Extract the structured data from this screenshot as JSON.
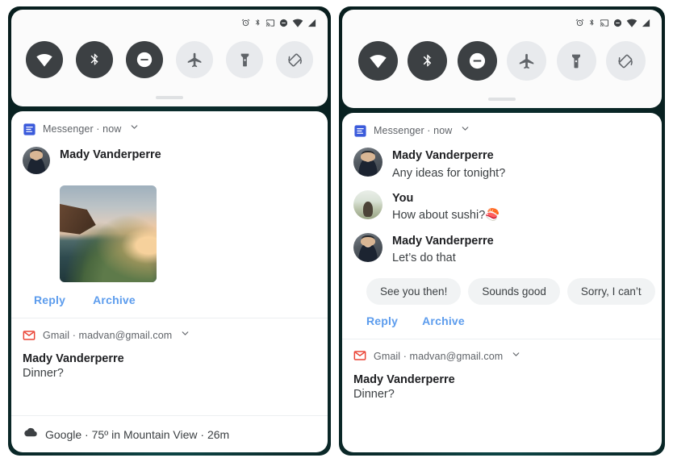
{
  "status_bar": {
    "icons": [
      "alarm-icon",
      "bluetooth-icon",
      "cast-icon",
      "do-not-disturb-icon",
      "wifi-icon",
      "cellular-signal-icon"
    ]
  },
  "quick_settings": {
    "tiles": [
      {
        "name": "wifi",
        "label": "Wi-Fi",
        "state": "on"
      },
      {
        "name": "bluetooth",
        "label": "Bluetooth",
        "state": "on"
      },
      {
        "name": "dnd",
        "label": "Do Not Disturb",
        "state": "on"
      },
      {
        "name": "airplane",
        "label": "Airplane mode",
        "state": "off"
      },
      {
        "name": "flashlight",
        "label": "Flashlight",
        "state": "off"
      },
      {
        "name": "autorotate",
        "label": "Auto-rotate",
        "state": "off"
      }
    ]
  },
  "left_panel": {
    "messenger": {
      "app_name": "Messenger",
      "separator": "·",
      "time": "now",
      "sender": "Mady Vanderperre",
      "attachment_alt": "coastal sunset photo",
      "actions": [
        "Reply",
        "Archive"
      ]
    },
    "gmail": {
      "app_name": "Gmail",
      "separator": "·",
      "account": "madvan@gmail.com",
      "title": "Mady Vanderperre",
      "text": "Dinner?"
    },
    "google": {
      "text": "Google · 75º in Mountain View · 26m"
    }
  },
  "right_panel": {
    "messenger": {
      "app_name": "Messenger",
      "separator": "·",
      "time": "now",
      "messages": [
        {
          "sender": "Mady Vanderperre",
          "text": "Any ideas for tonight?",
          "avatar": "person"
        },
        {
          "sender": "You",
          "text": "How about sushi?🍣",
          "avatar": "outdoor"
        },
        {
          "sender": "Mady Vanderperre",
          "text": "Let’s do that",
          "avatar": "person"
        }
      ],
      "smart_replies": [
        "See you then!",
        "Sounds good",
        "Sorry, I can’t"
      ],
      "actions": [
        "Reply",
        "Archive"
      ]
    },
    "gmail": {
      "app_name": "Gmail",
      "separator": "·",
      "account": "madvan@gmail.com",
      "title": "Mady Vanderperre",
      "text": "Dinner?"
    }
  },
  "colors": {
    "link": "#5c9ced",
    "tile_on": "#3c4043",
    "tile_off": "#e8eaed",
    "messenger_blue": "#3b5bdb",
    "gmail_red": "#ea4335",
    "wallpaper": "#0b3030"
  }
}
